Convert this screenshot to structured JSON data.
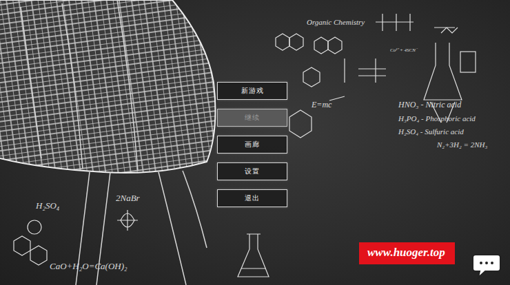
{
  "menu": {
    "items": [
      {
        "label": "新游戏",
        "disabled": false
      },
      {
        "label": "继续",
        "disabled": true
      },
      {
        "label": "画廊",
        "disabled": false
      },
      {
        "label": "设置",
        "disabled": false
      },
      {
        "label": "退出",
        "disabled": false
      }
    ]
  },
  "chalk_notes": [
    {
      "text": "Organic Chemistry"
    },
    {
      "text": "Co²⁺ + 4SCN⁻"
    },
    {
      "text": "E=mc"
    },
    {
      "text": "HNO₃ - Nitric acid"
    },
    {
      "text": "H₃PO₄ - Phosphoric acid"
    },
    {
      "text": "H₂SO₄ - Sulfuric acid"
    },
    {
      "text": "N₂+3H₂ = 2NH₃"
    },
    {
      "text": "2NaBr"
    },
    {
      "text": "H₂SO₄"
    },
    {
      "text": "CaO+H₂O=Ca(OH)₂"
    }
  ],
  "watermark": {
    "text": "www.huoger.top"
  }
}
